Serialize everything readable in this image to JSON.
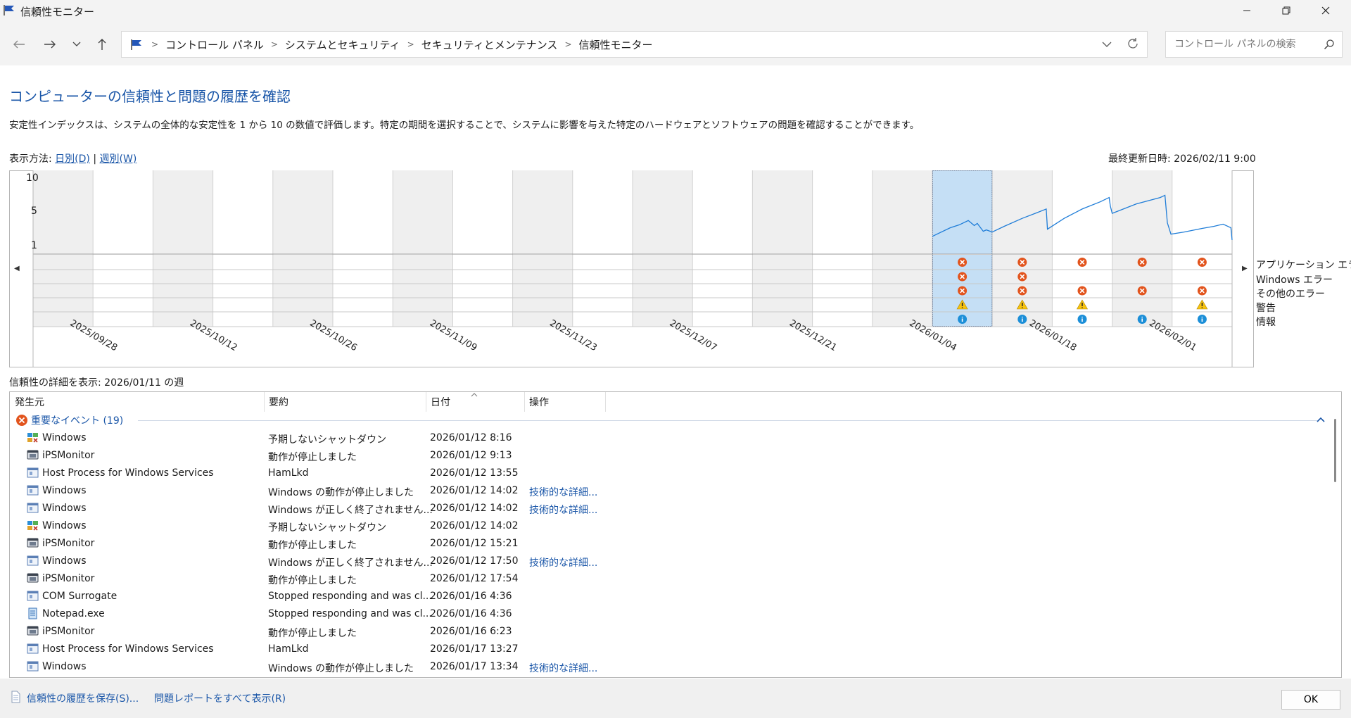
{
  "window": {
    "title": "信頼性モニター"
  },
  "breadcrumbs": [
    "コントロール パネル",
    "システムとセキュリティ",
    "セキュリティとメンテナンス",
    "信頼性モニター"
  ],
  "search": {
    "placeholder": "コントロール パネルの検索"
  },
  "page": {
    "heading": "コンピューターの信頼性と問題の履歴を確認",
    "description": "安定性インデックスは、システムの全体的な安定性を 1 から 10 の数値で評価します。特定の期間を選択することで、システムに影響を与えた特定のハードウェアとソフトウェアの問題を確認することができます。",
    "view_by_label": "表示方法:",
    "view_daily": "日別(D)",
    "view_sep": "|",
    "view_weekly": "週別(W)",
    "last_updated": "最終更新日時: 2026/02/11 9:00"
  },
  "chart_data": {
    "type": "line",
    "title": "",
    "ylabel": "",
    "ylim": [
      1,
      10
    ],
    "y_ticks": [
      "10",
      "5",
      "1"
    ],
    "columns": 20,
    "selected_column": 15,
    "x_tick_labels": [
      "2025/09/28",
      "2025/10/12",
      "2025/10/26",
      "2025/11/09",
      "2025/11/23",
      "2025/12/07",
      "2025/12/21",
      "2026/01/04",
      "2026/01/18",
      "2026/02/01"
    ],
    "category_labels": [
      "アプリケーション エラー",
      "Windows エラー",
      "その他のエラー",
      "警告",
      "情報"
    ],
    "stability_index": [
      {
        "col": 15.0,
        "y": 2.0
      },
      {
        "col": 15.1,
        "y": 2.4
      },
      {
        "col": 15.3,
        "y": 3.2
      },
      {
        "col": 15.45,
        "y": 3.6
      },
      {
        "col": 15.6,
        "y": 4.2
      },
      {
        "col": 15.7,
        "y": 3.5
      },
      {
        "col": 15.75,
        "y": 3.8
      },
      {
        "col": 15.85,
        "y": 2.7
      },
      {
        "col": 15.9,
        "y": 2.9
      },
      {
        "col": 16.0,
        "y": 2.6
      },
      {
        "col": 16.2,
        "y": 3.4
      },
      {
        "col": 16.5,
        "y": 4.5
      },
      {
        "col": 16.75,
        "y": 5.3
      },
      {
        "col": 16.9,
        "y": 5.8
      },
      {
        "col": 16.92,
        "y": 3.0
      },
      {
        "col": 17.2,
        "y": 4.5
      },
      {
        "col": 17.5,
        "y": 5.8
      },
      {
        "col": 17.8,
        "y": 6.8
      },
      {
        "col": 17.95,
        "y": 7.4
      },
      {
        "col": 17.97,
        "y": 6.2
      },
      {
        "col": 18.0,
        "y": 5.2
      },
      {
        "col": 18.4,
        "y": 6.5
      },
      {
        "col": 18.8,
        "y": 7.4
      },
      {
        "col": 18.88,
        "y": 7.7
      },
      {
        "col": 18.92,
        "y": 3.9
      },
      {
        "col": 18.98,
        "y": 2.3
      },
      {
        "col": 19.2,
        "y": 2.6
      },
      {
        "col": 19.5,
        "y": 3.1
      },
      {
        "col": 19.7,
        "y": 3.4
      },
      {
        "col": 19.85,
        "y": 3.7
      },
      {
        "col": 19.98,
        "y": 3.2
      },
      {
        "col": 20.0,
        "y": 1.5
      }
    ],
    "markers": {
      "app_error": [
        15,
        16,
        17,
        18,
        19
      ],
      "windows_error": [
        15,
        16
      ],
      "other_error": [
        15,
        16,
        17,
        18,
        19
      ],
      "warning": [
        15,
        16,
        17,
        19
      ],
      "info": [
        15,
        16,
        17,
        18,
        19
      ]
    },
    "colors": {
      "line": "#1f7dd8",
      "selected_fill": "#c5dff5",
      "gray_band": "#efefef",
      "error": "#e2541d",
      "warning": "#f7c30e",
      "info": "#1c8fd8"
    }
  },
  "details": {
    "title": "信頼性の詳細を表示: 2026/01/11 の週",
    "columns": [
      "発生元",
      "要約",
      "日付",
      "操作"
    ],
    "group_label": "重要なイベント (19)",
    "rows": [
      {
        "source": "Windows",
        "summary": "予期しないシャットダウン",
        "date": "2026/01/12 8:16",
        "action": "",
        "icon": "windows-shutdown-icon"
      },
      {
        "source": "iPSMonitor",
        "summary": "動作が停止しました",
        "date": "2026/01/12 9:13",
        "action": "",
        "icon": "app-window-icon"
      },
      {
        "source": "Host Process for Windows Services",
        "summary": "HamLkd",
        "date": "2026/01/12 13:55",
        "action": "",
        "icon": "service-window-icon"
      },
      {
        "source": "Windows",
        "summary": "Windows の動作が停止しました",
        "date": "2026/01/12 14:02",
        "action": "技術的な詳細...",
        "icon": "service-window-icon"
      },
      {
        "source": "Windows",
        "summary": "Windows が正しく終了されません...",
        "date": "2026/01/12 14:02",
        "action": "技術的な詳細...",
        "icon": "service-window-icon"
      },
      {
        "source": "Windows",
        "summary": "予期しないシャットダウン",
        "date": "2026/01/12 14:02",
        "action": "",
        "icon": "windows-shutdown-icon"
      },
      {
        "source": "iPSMonitor",
        "summary": "動作が停止しました",
        "date": "2026/01/12 15:21",
        "action": "",
        "icon": "app-window-icon"
      },
      {
        "source": "Windows",
        "summary": "Windows が正しく終了されません...",
        "date": "2026/01/12 17:50",
        "action": "技術的な詳細...",
        "icon": "service-window-icon"
      },
      {
        "source": "iPSMonitor",
        "summary": "動作が停止しました",
        "date": "2026/01/12 17:54",
        "action": "",
        "icon": "app-window-icon"
      },
      {
        "source": "COM Surrogate",
        "summary": "Stopped responding and was cl...",
        "date": "2026/01/16 4:36",
        "action": "",
        "icon": "service-window-icon"
      },
      {
        "source": "Notepad.exe",
        "summary": "Stopped responding and was cl...",
        "date": "2026/01/16 4:36",
        "action": "",
        "icon": "notepad-icon"
      },
      {
        "source": "iPSMonitor",
        "summary": "動作が停止しました",
        "date": "2026/01/16 6:23",
        "action": "",
        "icon": "app-window-icon"
      },
      {
        "source": "Host Process for Windows Services",
        "summary": "HamLkd",
        "date": "2026/01/17 13:27",
        "action": "",
        "icon": "service-window-icon"
      },
      {
        "source": "Windows",
        "summary": "Windows の動作が停止しました",
        "date": "2026/01/17 13:34",
        "action": "技術的な詳細...",
        "icon": "service-window-icon"
      }
    ]
  },
  "footer": {
    "save_history": "信頼性の履歴を保存(S)...",
    "view_all_reports": "問題レポートをすべて表示(R)",
    "ok": "OK"
  }
}
